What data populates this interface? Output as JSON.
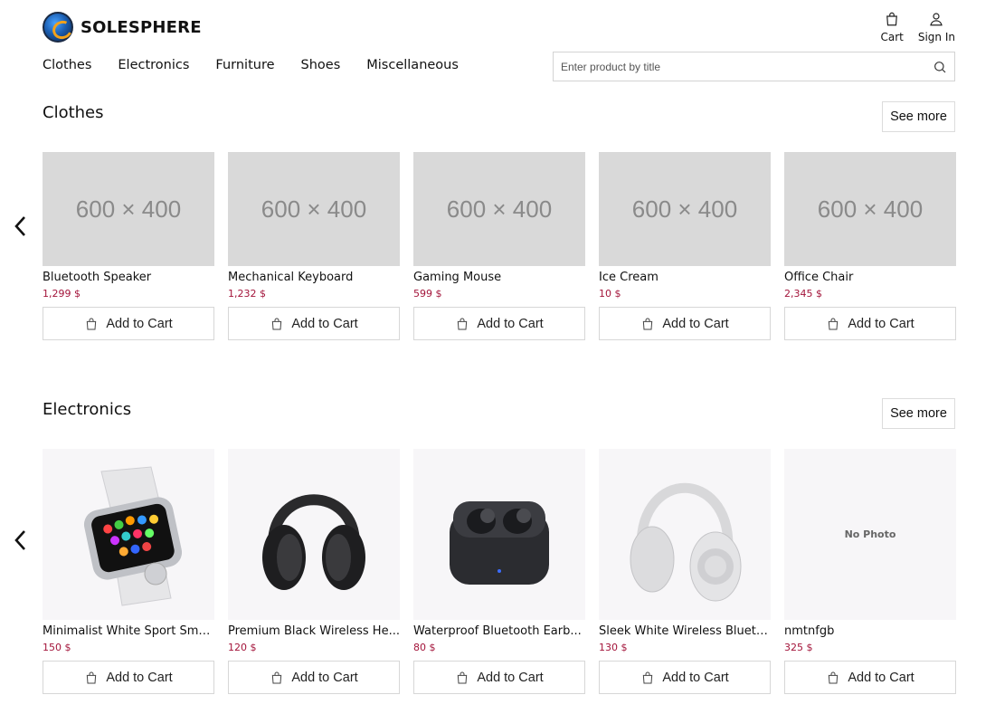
{
  "brand": {
    "name": "SOLESPHERE"
  },
  "header": {
    "cart_label": "Cart",
    "signin_label": "Sign In"
  },
  "nav": [
    "Clothes",
    "Electronics",
    "Furniture",
    "Shoes",
    "Miscellaneous"
  ],
  "search": {
    "placeholder": "Enter product by title"
  },
  "sections": [
    {
      "title": "Clothes",
      "see_more": "See more",
      "products": [
        {
          "name": "Bluetooth Speaker",
          "price": "1,299 $",
          "image_text": "600 × 400",
          "cta": "Add to Cart"
        },
        {
          "name": "Mechanical Keyboard",
          "price": "1,232 $",
          "image_text": "600 × 400",
          "cta": "Add to Cart"
        },
        {
          "name": "Gaming Mouse",
          "price": "599 $",
          "image_text": "600 × 400",
          "cta": "Add to Cart"
        },
        {
          "name": "Ice Cream",
          "price": "10 $",
          "image_text": "600 × 400",
          "cta": "Add to Cart"
        },
        {
          "name": "Office Chair",
          "price": "2,345 $",
          "image_text": "600 × 400",
          "cta": "Add to Cart"
        }
      ]
    },
    {
      "title": "Electronics",
      "see_more": "See more",
      "products": [
        {
          "name": "Minimalist White Sport Sma...",
          "price": "150 $",
          "image_icon": "smartwatch-image",
          "cta": "Add to Cart"
        },
        {
          "name": "Premium Black Wireless He...",
          "price": "120 $",
          "image_icon": "black-headphones-image",
          "cta": "Add to Cart"
        },
        {
          "name": "Waterproof Bluetooth Earb...",
          "price": "80 $",
          "image_icon": "earbuds-image",
          "cta": "Add to Cart"
        },
        {
          "name": "Sleek White Wireless Blueto...",
          "price": "130 $",
          "image_icon": "white-headphones-image",
          "cta": "Add to Cart"
        },
        {
          "name": "nmtnfgb",
          "price": "325 $",
          "image_text": "No Photo",
          "cta": "Add to Cart"
        }
      ]
    }
  ]
}
